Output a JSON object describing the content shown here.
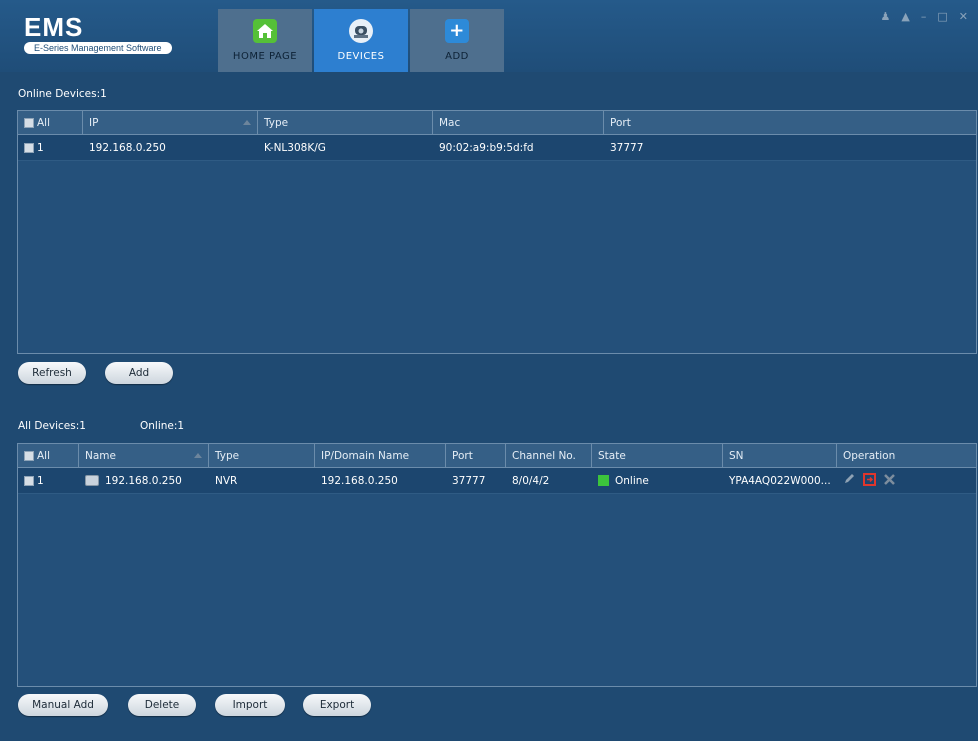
{
  "app": {
    "logo_title": "EMS",
    "logo_subtitle": "E-Series Management Software"
  },
  "tabs": [
    {
      "label": "HOME PAGE",
      "icon": "home-icon",
      "active": false
    },
    {
      "label": "DEVICES",
      "icon": "devices-icon",
      "active": true
    },
    {
      "label": "ADD",
      "icon": "add-icon",
      "active": false
    }
  ],
  "window_controls": [
    "user-icon",
    "lock-icon",
    "minimize-icon",
    "maximize-icon",
    "close-icon"
  ],
  "online_devices": {
    "label": "Online Devices:1",
    "columns": {
      "all": "All",
      "ip": "IP",
      "type": "Type",
      "mac": "Mac",
      "port": "Port"
    },
    "rows": [
      {
        "index": "1",
        "ip": "192.168.0.250",
        "type": "K-NL308K/G",
        "mac": "90:02:a9:b9:5d:fd",
        "port": "37777"
      }
    ],
    "buttons": {
      "refresh": "Refresh",
      "add": "Add"
    }
  },
  "all_devices": {
    "label_all": "All Devices:1",
    "label_online": "Online:1",
    "columns": {
      "all": "All",
      "name": "Name",
      "type": "Type",
      "ip": "IP/Domain Name",
      "port": "Port",
      "channel": "Channel No.",
      "state": "State",
      "sn": "SN",
      "operation": "Operation"
    },
    "rows": [
      {
        "index": "1",
        "name": "192.168.0.250",
        "type": "NVR",
        "ip": "192.168.0.250",
        "port": "37777",
        "channel": "8/0/4/2",
        "state": "Online",
        "sn": "YPA4AQ022W000..."
      }
    ],
    "buttons": {
      "manual_add": "Manual Add",
      "delete": "Delete",
      "import": "Import",
      "export": "Export"
    }
  },
  "colors": {
    "background": "#1f4a72",
    "active_tab": "#2d7fd0",
    "online_state": "#3cc43c",
    "operation_export": "#e0362c"
  }
}
